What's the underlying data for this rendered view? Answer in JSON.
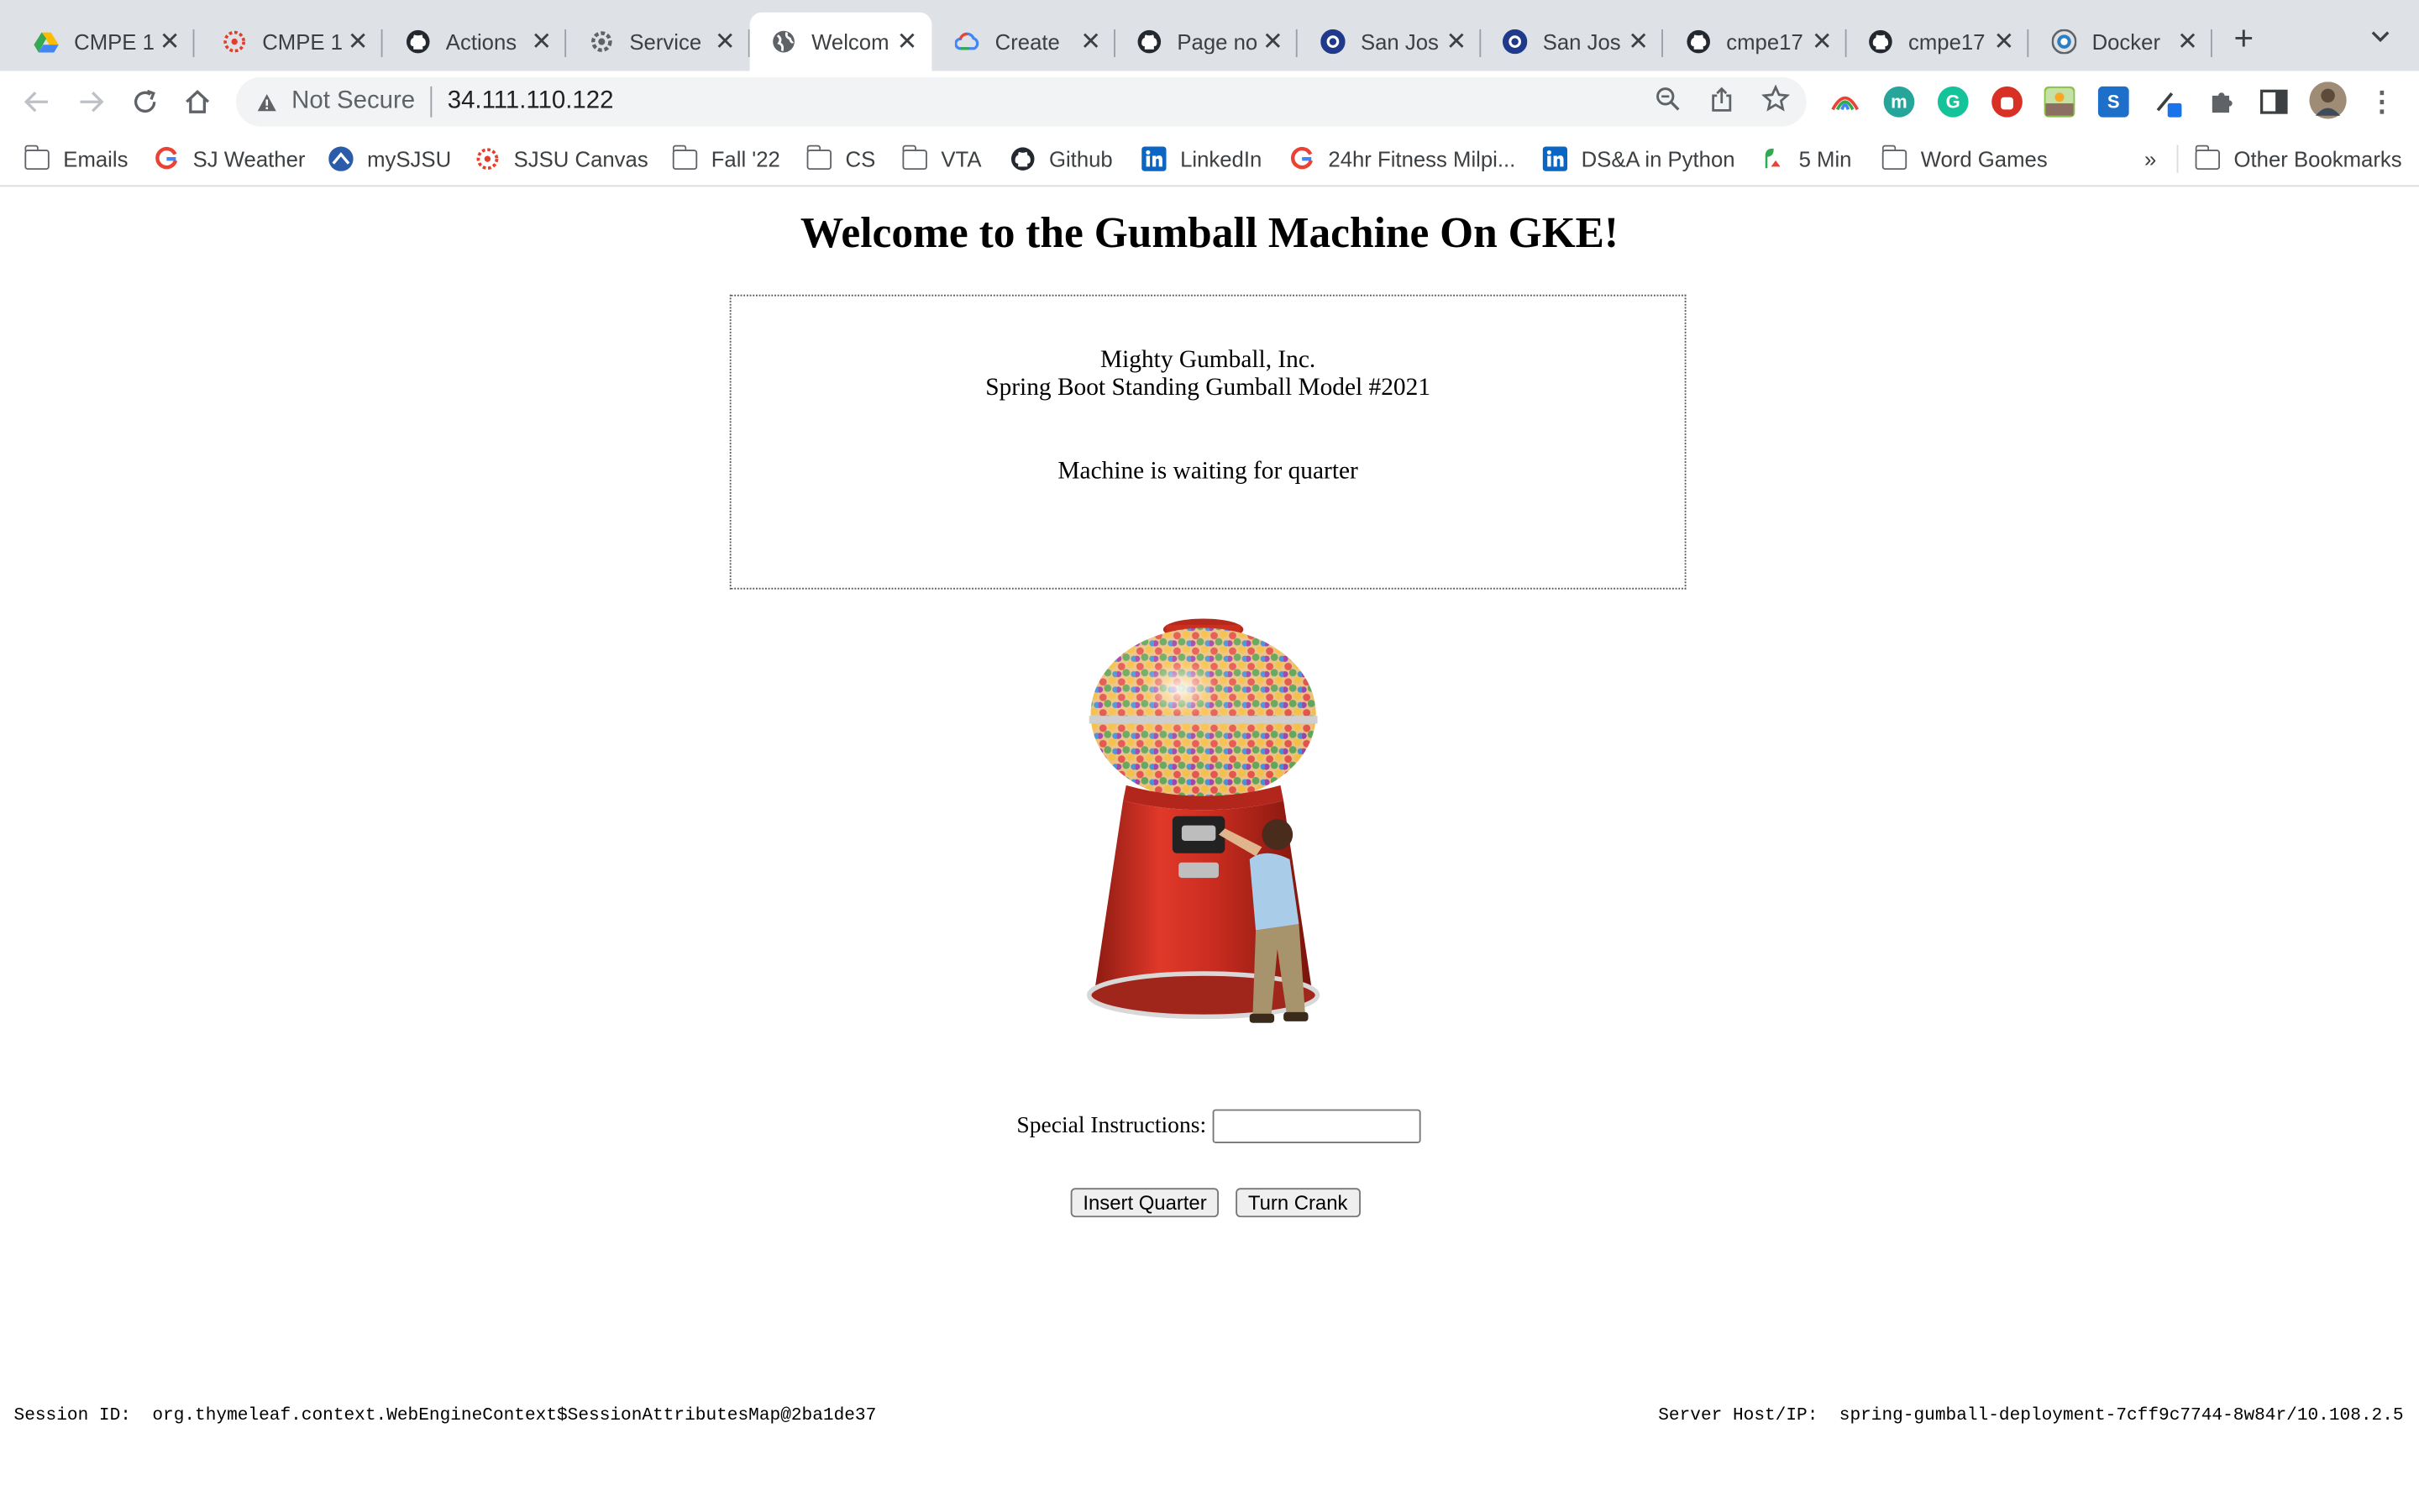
{
  "browser": {
    "tabs": [
      {
        "label": "CMPE 1",
        "icon": "google-drive-icon"
      },
      {
        "label": "CMPE 1",
        "icon": "canvas-icon"
      },
      {
        "label": "Actions",
        "icon": "github-icon"
      },
      {
        "label": "Service",
        "icon": "gcp-gear-icon"
      },
      {
        "label": "Welcom",
        "icon": "globe-icon",
        "active": true
      },
      {
        "label": "Create",
        "icon": "google-cloud-icon"
      },
      {
        "label": "Page no",
        "icon": "github-icon"
      },
      {
        "label": "San Jos",
        "icon": "circle-icon"
      },
      {
        "label": "San Jos",
        "icon": "circle-icon"
      },
      {
        "label": "cmpe17",
        "icon": "github-icon"
      },
      {
        "label": "cmpe17",
        "icon": "github-icon"
      },
      {
        "label": "Docker",
        "icon": "docker-icon"
      }
    ],
    "security_label": "Not Secure",
    "url": "34.111.110.122",
    "bookmarks": [
      {
        "label": "Emails",
        "icon": "folder-icon"
      },
      {
        "label": "SJ Weather",
        "icon": "google-icon"
      },
      {
        "label": "mySJSU",
        "icon": "mysjsu-icon"
      },
      {
        "label": "SJSU Canvas",
        "icon": "canvas-icon"
      },
      {
        "label": "Fall '22",
        "icon": "folder-icon"
      },
      {
        "label": "CS",
        "icon": "folder-icon"
      },
      {
        "label": "VTA",
        "icon": "folder-icon"
      },
      {
        "label": "Github",
        "icon": "github-icon"
      },
      {
        "label": "LinkedIn",
        "icon": "linkedin-icon"
      },
      {
        "label": "24hr Fitness Milpi...",
        "icon": "google-icon"
      },
      {
        "label": "DS&A in Python",
        "icon": "linkedin-icon"
      },
      {
        "label": "5 Min",
        "icon": "plant-icon"
      },
      {
        "label": "Word Games",
        "icon": "folder-icon"
      }
    ],
    "overflow_label": "»",
    "other_bookmarks": "Other Bookmarks"
  },
  "page": {
    "heading": "Welcome to the Gumball Machine On GKE!",
    "company": "Mighty Gumball, Inc.",
    "model": "Spring Boot Standing Gumball Model #2021",
    "state": "Machine is waiting for quarter",
    "instructions_label": "Special Instructions:",
    "instructions_value": "",
    "insert_button": "Insert Quarter",
    "crank_button": "Turn Crank",
    "session_label": "Session ID:",
    "session_value": "org.thymeleaf.context.WebEngineContext$SessionAttributesMap@2ba1de37",
    "server_label": "Server Host/IP:",
    "server_value": "spring-gumball-deployment-7cff9c7744-8w84r/10.108.2.5"
  },
  "colors": {
    "tabstrip": "#dee1e6",
    "gumball_red": "#d93a2b"
  }
}
